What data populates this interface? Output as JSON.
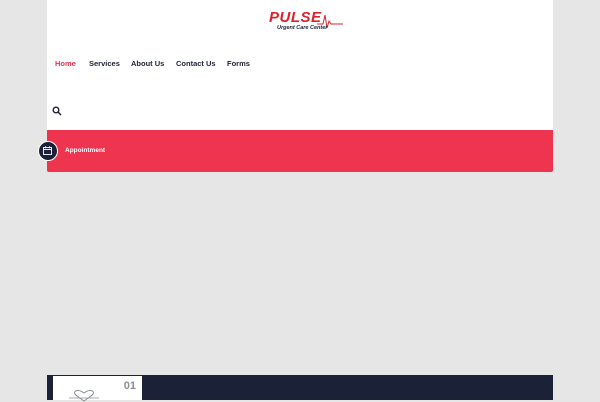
{
  "brand": {
    "name": "PULSE",
    "tagline": "Urgent Care Center",
    "primary_color": "#d8232a",
    "accent_color": "#ef3450",
    "dark_color": "#1b2038"
  },
  "nav": {
    "items": [
      {
        "label": "Home",
        "active": true
      },
      {
        "label": "Services",
        "active": false
      },
      {
        "label": "About Us",
        "active": false
      },
      {
        "label": "Contact Us",
        "active": false
      },
      {
        "label": "Forms",
        "active": false
      }
    ],
    "search_icon": "search-icon"
  },
  "appointment": {
    "label": "Appointment",
    "icon": "calendar-icon"
  },
  "feature_card": {
    "number": "01",
    "icon": "heart-outline-icon"
  }
}
